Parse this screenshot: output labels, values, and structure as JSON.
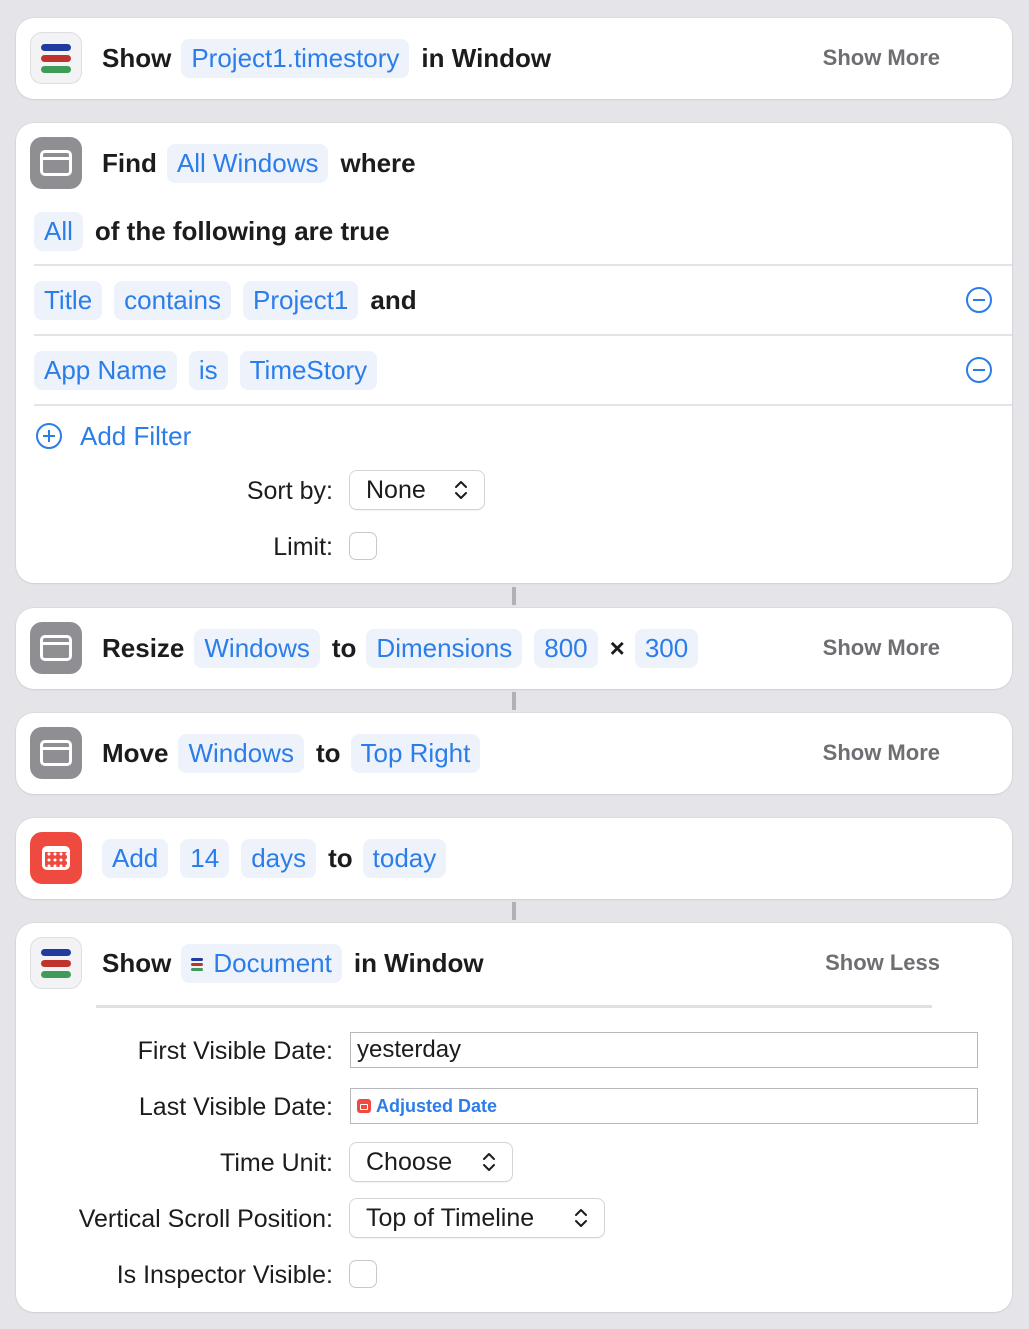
{
  "colors": {
    "accent": "#2b7de9",
    "token_bg": "#eef3fb",
    "timestory_blue": "#1f3c9e",
    "timestory_red": "#c0322c",
    "timestory_green": "#3f9b58",
    "window_gray": "#8e8e93",
    "calendar_red": "#ef4a3f"
  },
  "action1": {
    "icon": "timestory-app-icon",
    "verb": "Show",
    "document": "Project1.timestory",
    "suffix": "in Window",
    "toggle": "Show More"
  },
  "action2": {
    "icon": "window-icon",
    "verb": "Find",
    "target": "All Windows",
    "where": "where",
    "quantifier": "All",
    "quantifier_suffix": "of the following are true",
    "filters": [
      {
        "field": "Title",
        "operator": "contains",
        "value": "Project1",
        "conj": "and"
      },
      {
        "field": "App Name",
        "operator": "is",
        "value": "TimeStory"
      }
    ],
    "add_filter": "Add Filter",
    "sort_label": "Sort by:",
    "sort_value": "None",
    "limit_label": "Limit:"
  },
  "action3": {
    "icon": "window-icon",
    "verb": "Resize",
    "target": "Windows",
    "to": "to",
    "mode": "Dimensions",
    "width": "800",
    "times": "×",
    "height": "300",
    "toggle": "Show More"
  },
  "action4": {
    "icon": "window-icon",
    "verb": "Move",
    "target": "Windows",
    "to": "to",
    "position": "Top Right",
    "toggle": "Show More"
  },
  "action5": {
    "icon": "calendar-icon",
    "operation": "Add",
    "amount": "14",
    "unit": "days",
    "to": "to",
    "base": "today"
  },
  "action6": {
    "icon": "timestory-app-icon",
    "verb": "Show",
    "document": "Document",
    "suffix": "in Window",
    "toggle": "Show Less",
    "first_label": "First Visible Date:",
    "first_value": "yesterday",
    "last_label": "Last Visible Date:",
    "last_value": "Adjusted Date",
    "unit_label": "Time Unit:",
    "unit_value": "Choose",
    "scroll_label": "Vertical Scroll Position:",
    "scroll_value": "Top of Timeline",
    "inspector_label": "Is Inspector Visible:"
  }
}
